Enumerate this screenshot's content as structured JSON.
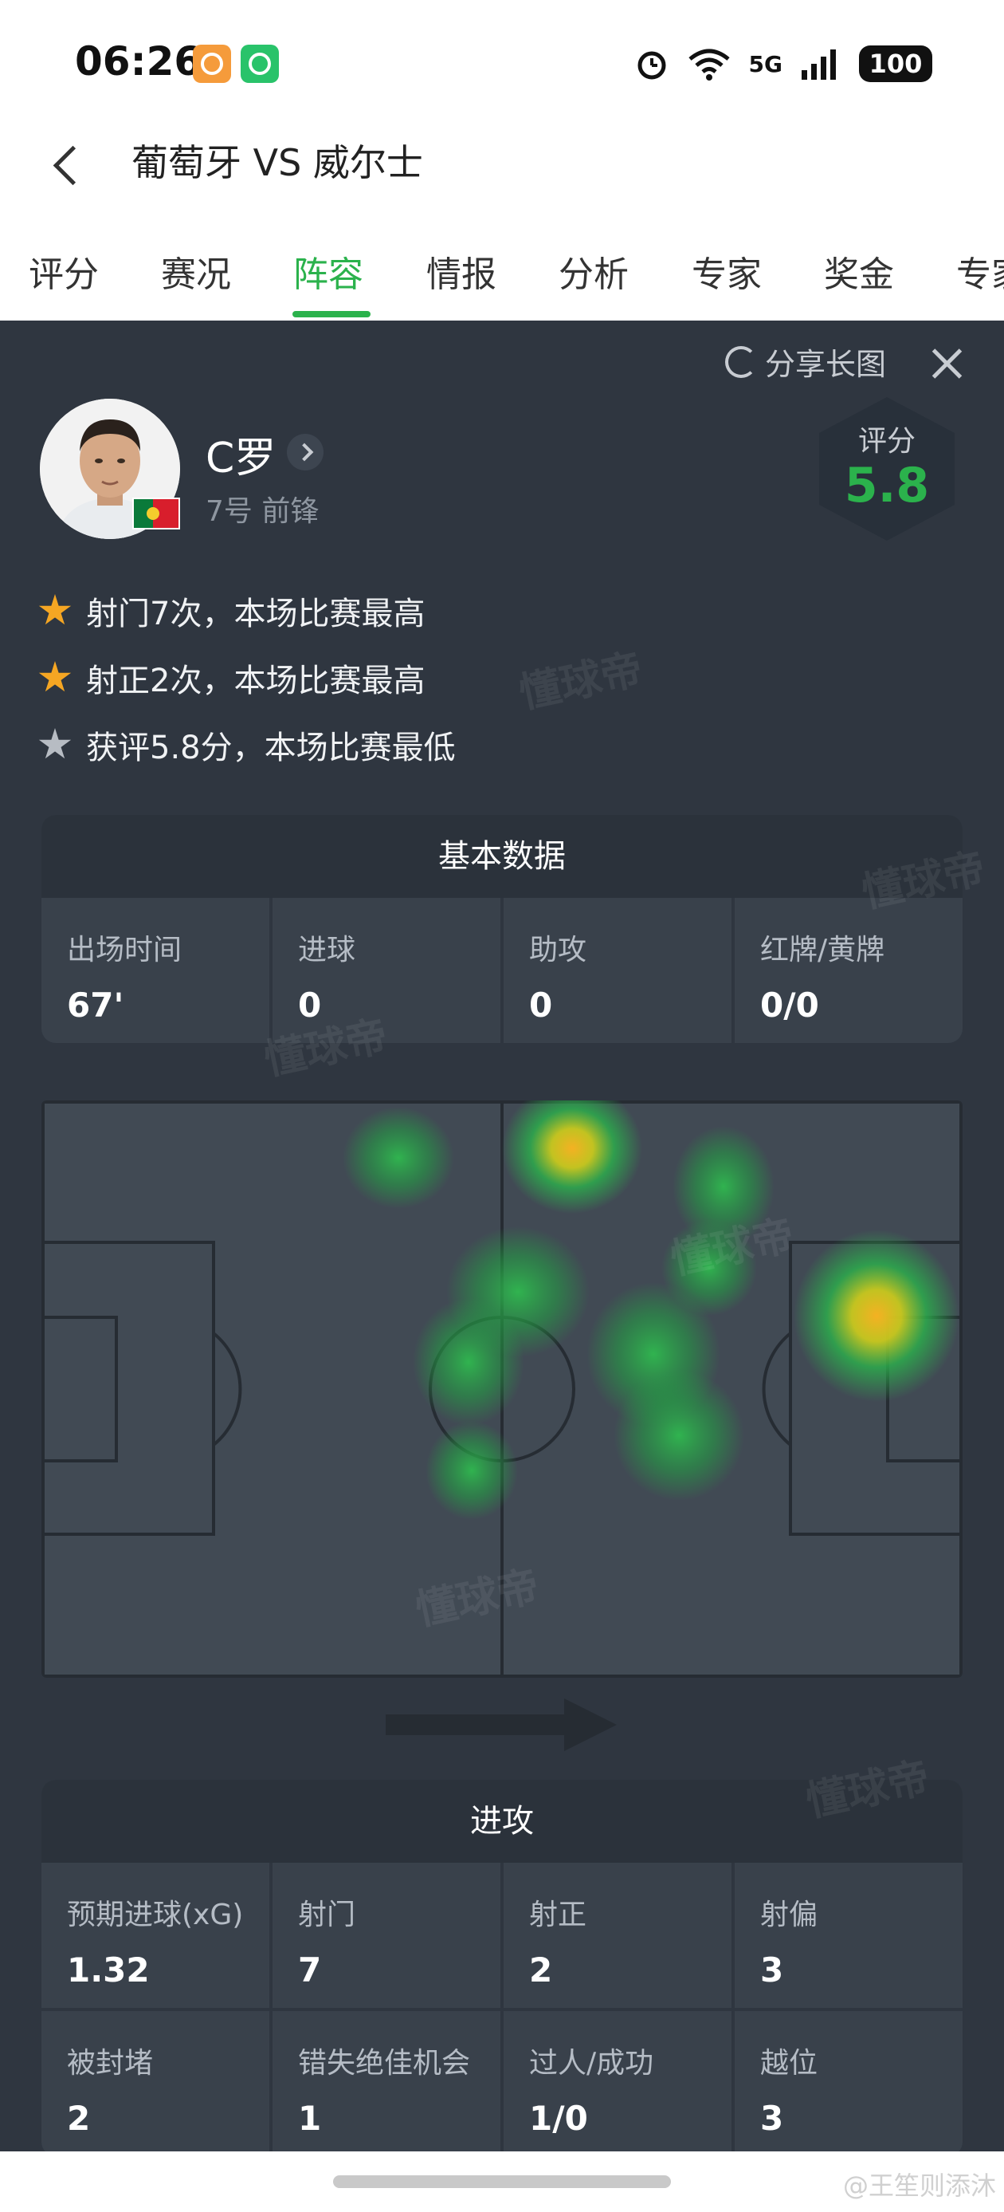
{
  "status_bar": {
    "time": "06:26",
    "network": "5G",
    "battery": "100"
  },
  "nav": {
    "title": "葡萄牙 VS 威尔士"
  },
  "tabs": [
    {
      "label": "评分"
    },
    {
      "label": "赛况"
    },
    {
      "label": "阵容",
      "active": true
    },
    {
      "label": "情报"
    },
    {
      "label": "分析"
    },
    {
      "label": "专家"
    },
    {
      "label": "奖金"
    },
    {
      "label": "专家"
    }
  ],
  "panel": {
    "share_label": "分享长图",
    "player": {
      "name": "C罗",
      "role": "7号 前锋",
      "rating_label": "评分",
      "rating": "5.8"
    },
    "highlights": [
      {
        "text": "射门7次，本场比赛最高",
        "icon": "gold-star-icon"
      },
      {
        "text": "射正2次，本场比赛最高",
        "icon": "gold-star-icon"
      },
      {
        "text": "获评5.8分，本场比赛最低",
        "icon": "grey-star-icon"
      }
    ],
    "basic": {
      "title": "基本数据",
      "stats": [
        {
          "label": "出场时间",
          "value": "67'"
        },
        {
          "label": "进球",
          "value": "0"
        },
        {
          "label": "助攻",
          "value": "0"
        },
        {
          "label": "红牌/黄牌",
          "value": "0/0"
        }
      ]
    },
    "attack": {
      "title": "进攻",
      "stats": [
        {
          "label": "预期进球(xG)",
          "value": "1.32"
        },
        {
          "label": "射门",
          "value": "7"
        },
        {
          "label": "射正",
          "value": "2"
        },
        {
          "label": "射偏",
          "value": "3"
        },
        {
          "label": "被封堵",
          "value": "2"
        },
        {
          "label": "错失绝佳机会",
          "value": "1"
        },
        {
          "label": "过人/成功",
          "value": "1/0"
        },
        {
          "label": "越位",
          "value": "3"
        }
      ]
    },
    "watermark": "懂球帝"
  },
  "footer": {
    "weibo": "@王笙则添沐"
  },
  "colors": {
    "accent": "#2bb24c",
    "panel_bg": "#2f3640",
    "card_bg": "#39414b"
  }
}
